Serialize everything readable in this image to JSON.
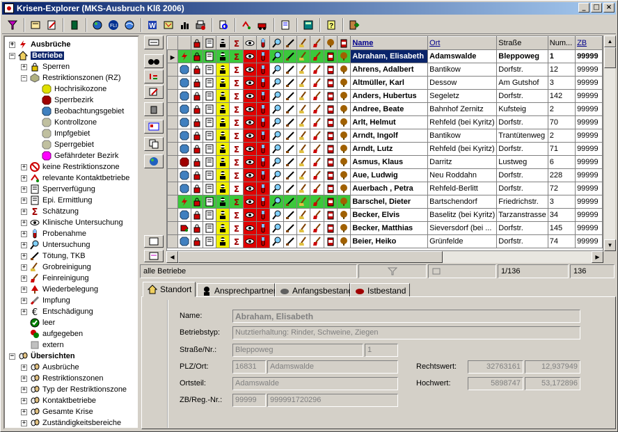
{
  "window": {
    "title": "Krisen-Explorer  (MKS-Ausbruch Klß 2006)",
    "controls": [
      "_",
      "□",
      "×"
    ]
  },
  "toolbar": {
    "buttons": [
      "filter-icon",
      "edit-icon",
      "notes-icon",
      "book-icon",
      "globe-icon",
      "fli-icon",
      "globe2-icon",
      "word-icon",
      "map-icon",
      "chart-icon",
      "print-icon",
      "search-icon",
      "transfer-icon",
      "vehicle-icon",
      "form-icon",
      "calculator-icon",
      "help-icon",
      "exit-icon"
    ]
  },
  "tree": {
    "nodes": [
      {
        "label": "Ausbrüche",
        "expander": "+",
        "bold": true
      },
      {
        "label": "Betriebe",
        "expander": "-",
        "bold": true,
        "selected": true
      },
      {
        "label": "Sperren",
        "expander": "+"
      },
      {
        "label": "Restriktionszonen (RZ)",
        "expander": "-"
      },
      {
        "label": "Hochrisikozone"
      },
      {
        "label": "Sperrbezirk"
      },
      {
        "label": "Beobachtungsgebiet"
      },
      {
        "label": "Kontrollzone"
      },
      {
        "label": "Impfgebiet"
      },
      {
        "label": "Sperrgebiet"
      },
      {
        "label": "Gefährdeter Bezirk"
      },
      {
        "label": "keine Restriktionszone",
        "expander": "+"
      },
      {
        "label": "relevante Kontaktbetriebe",
        "expander": "+"
      },
      {
        "label": "Sperrverfügung",
        "expander": "+"
      },
      {
        "label": "Epi. Ermittlung",
        "expander": "+"
      },
      {
        "label": "Schätzung",
        "expander": "+"
      },
      {
        "label": "Klinische Untersuchung",
        "expander": "+"
      },
      {
        "label": "Probenahme",
        "expander": "+"
      },
      {
        "label": "Untersuchung",
        "expander": "+"
      },
      {
        "label": "Tötung, TKB",
        "expander": "+"
      },
      {
        "label": "Grobreinigung",
        "expander": "+"
      },
      {
        "label": "Feinreinigung",
        "expander": "+"
      },
      {
        "label": "Wiederbelegung",
        "expander": "+"
      },
      {
        "label": "Impfung",
        "expander": "+"
      },
      {
        "label": "Entschädigung",
        "expander": "+"
      },
      {
        "label": "leer"
      },
      {
        "label": "aufgegeben"
      },
      {
        "label": "extern"
      },
      {
        "label": "Übersichten",
        "expander": "-",
        "bold": true
      },
      {
        "label": "Ausbrüche",
        "expander": "+"
      },
      {
        "label": "Restriktionszonen",
        "expander": "+"
      },
      {
        "label": "Typ der Restriktionszone",
        "expander": "+"
      },
      {
        "label": "Kontaktbetriebe",
        "expander": "+"
      },
      {
        "label": "Gesamte Krise",
        "expander": "+"
      },
      {
        "label": "Zuständigkeitsbereiche",
        "expander": "+"
      }
    ]
  },
  "grid": {
    "columns": [
      "Name",
      "Ort",
      "Straße",
      "Num...",
      "ZB"
    ],
    "rows": [
      {
        "name": "Abraham, Elisabeth",
        "ort": "Adamswalde",
        "strasse": "Bleppoweg",
        "num": "1",
        "zb": "99999"
      },
      {
        "name": "Ahrens, Adalbert",
        "ort": "Bantikow",
        "strasse": "Dorfstr.",
        "num": "12",
        "zb": "99999"
      },
      {
        "name": "Altmüller, Karl",
        "ort": "Dessow",
        "strasse": "Am Gutshof",
        "num": "3",
        "zb": "99999"
      },
      {
        "name": "Anders, Hubertus",
        "ort": "Segeletz",
        "strasse": "Dorfstr.",
        "num": "142",
        "zb": "99999"
      },
      {
        "name": "Andree, Beate",
        "ort": "Bahnhof Zernitz",
        "strasse": "Kufsteig",
        "num": "2",
        "zb": "99999"
      },
      {
        "name": "Arlt, Helmut",
        "ort": "Rehfeld (bei Kyritz)",
        "strasse": "Dorfstr.",
        "num": "70",
        "zb": "99999"
      },
      {
        "name": "Arndt, Ingolf",
        "ort": "Bantikow",
        "strasse": "Trantütenweg",
        "num": "2",
        "zb": "99999"
      },
      {
        "name": "Arndt, Lutz",
        "ort": "Rehfeld (bei Kyritz)",
        "strasse": "Dorfstr.",
        "num": "71",
        "zb": "99999"
      },
      {
        "name": "Asmus, Klaus",
        "ort": "Darritz",
        "strasse": "Lustweg",
        "num": "6",
        "zb": "99999"
      },
      {
        "name": "Aue, Ludwig",
        "ort": "Neu Roddahn",
        "strasse": "Dorfstr.",
        "num": "228",
        "zb": "99999"
      },
      {
        "name": "Auerbach , Petra",
        "ort": "Rehfeld-Berlitt",
        "strasse": "Dorfstr.",
        "num": "72",
        "zb": "99999"
      },
      {
        "name": "Barschel, Dieter",
        "ort": "Bartschendorf",
        "strasse": "Friedrichstr.",
        "num": "3",
        "zb": "99999"
      },
      {
        "name": "Becker, Elvis",
        "ort": "Baselitz (bei Kyritz)",
        "strasse": "Tarzanstrasse",
        "num": "34",
        "zb": "99999"
      },
      {
        "name": "Becker, Matthias",
        "ort": "Sieversdorf (bei ...",
        "strasse": "Dorfstr.",
        "num": "145",
        "zb": "99999"
      },
      {
        "name": "Beier, Heiko",
        "ort": "Grünfelde",
        "strasse": "Dorfstr.",
        "num": "74",
        "zb": "99999"
      }
    ]
  },
  "status": {
    "filter_text": "alle Betriebe",
    "position": "1/136",
    "count": "136"
  },
  "tabs": [
    {
      "label": "Standort",
      "active": true
    },
    {
      "label": "Ansprechpartner"
    },
    {
      "label": "Anfangsbestand"
    },
    {
      "label": "Istbestand"
    }
  ],
  "detail": {
    "name_label": "Name:",
    "name": "Abraham, Elisabeth",
    "typ_label": "Betriebstyp:",
    "typ": "Nutztierhaltung: Rinder, Schweine, Ziegen",
    "strasse_label": "Straße/Nr.:",
    "strasse": "Bleppoweg",
    "nr": "1",
    "plz_label": "PLZ/Ort:",
    "plz": "16831",
    "ort": "Adamswalde",
    "ortsteil_label": "Ortsteil:",
    "ortsteil": "Adamswalde",
    "zb_label": "ZB/Reg.-Nr.:",
    "zb": "99999",
    "regnr": "999991720296",
    "rechtswert_label": "Rechtswert:",
    "rechtswert1": "32763161",
    "rechtswert2": "12,937949",
    "hochwert_label": "Hochwert:",
    "hochwert1": "5898747",
    "hochwert2": "53,172896"
  }
}
